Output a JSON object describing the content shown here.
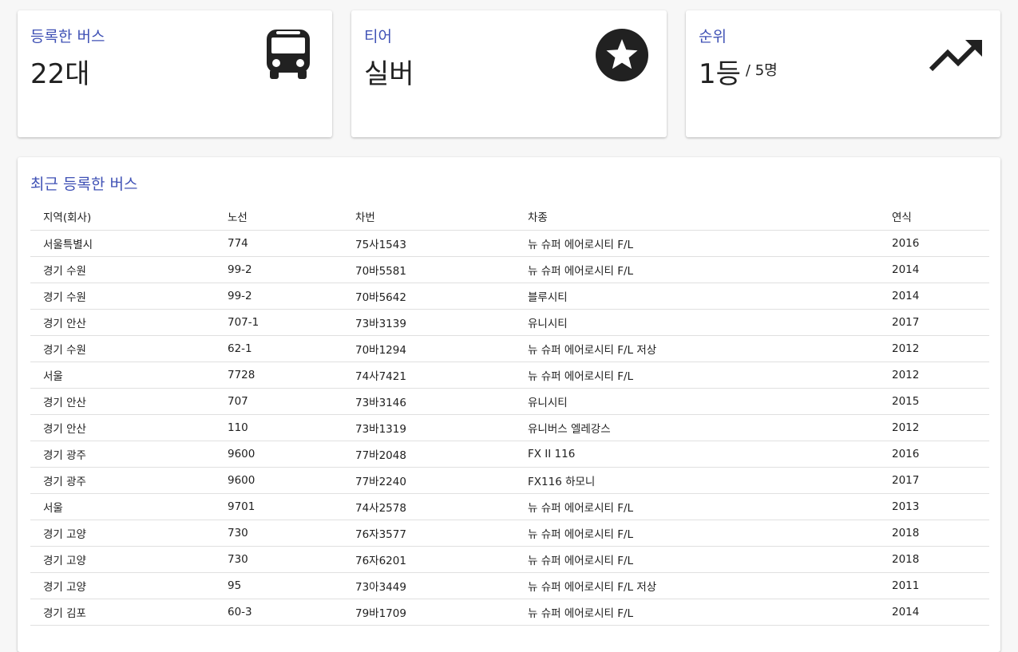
{
  "stats": {
    "bus": {
      "label": "등록한 버스",
      "value": "22대",
      "icon": "bus-icon"
    },
    "tier": {
      "label": "티어",
      "value": "실버",
      "icon": "star-circle-icon"
    },
    "rank": {
      "label": "순위",
      "value": "1등",
      "sub": "/ 5명",
      "icon": "trending-up-icon"
    }
  },
  "colors": {
    "accent": "#3f51b5",
    "text": "#212121",
    "icon": "#212121"
  },
  "recent": {
    "title": "최근 등록한 버스",
    "headers": [
      "지역(회사)",
      "노선",
      "차번",
      "차종",
      "연식"
    ],
    "rows": [
      [
        "서울특별시",
        "774",
        "75사1543",
        "뉴 슈퍼 에어로시티 F/L",
        "2016"
      ],
      [
        "경기 수원",
        "99-2",
        "70바5581",
        "뉴 슈퍼 에어로시티 F/L",
        "2014"
      ],
      [
        "경기 수원",
        "99-2",
        "70바5642",
        "블루시티",
        "2014"
      ],
      [
        "경기 안산",
        "707-1",
        "73바3139",
        "유니시티",
        "2017"
      ],
      [
        "경기 수원",
        "62-1",
        "70바1294",
        "뉴 슈퍼 에어로시티 F/L 저상",
        "2012"
      ],
      [
        "서울",
        "7728",
        "74사7421",
        "뉴 슈퍼 에어로시티 F/L",
        "2012"
      ],
      [
        "경기 안산",
        "707",
        "73바3146",
        "유니시티",
        "2015"
      ],
      [
        "경기 안산",
        "110",
        "73바1319",
        "유니버스 엘레강스",
        "2012"
      ],
      [
        "경기 광주",
        "9600",
        "77바2048",
        "FX II 116",
        "2016"
      ],
      [
        "경기 광주",
        "9600",
        "77바2240",
        "FX116 하모니",
        "2017"
      ],
      [
        "서울",
        "9701",
        "74사2578",
        "뉴 슈퍼 에어로시티 F/L",
        "2013"
      ],
      [
        "경기 고양",
        "730",
        "76자3577",
        "뉴 슈퍼 에어로시티 F/L",
        "2018"
      ],
      [
        "경기 고양",
        "730",
        "76자6201",
        "뉴 슈퍼 에어로시티 F/L",
        "2018"
      ],
      [
        "경기 고양",
        "95",
        "73아3449",
        "뉴 슈퍼 에어로시티 F/L 저상",
        "2011"
      ],
      [
        "경기 김포",
        "60-3",
        "79바1709",
        "뉴 슈퍼 에어로시티 F/L",
        "2014"
      ]
    ]
  }
}
